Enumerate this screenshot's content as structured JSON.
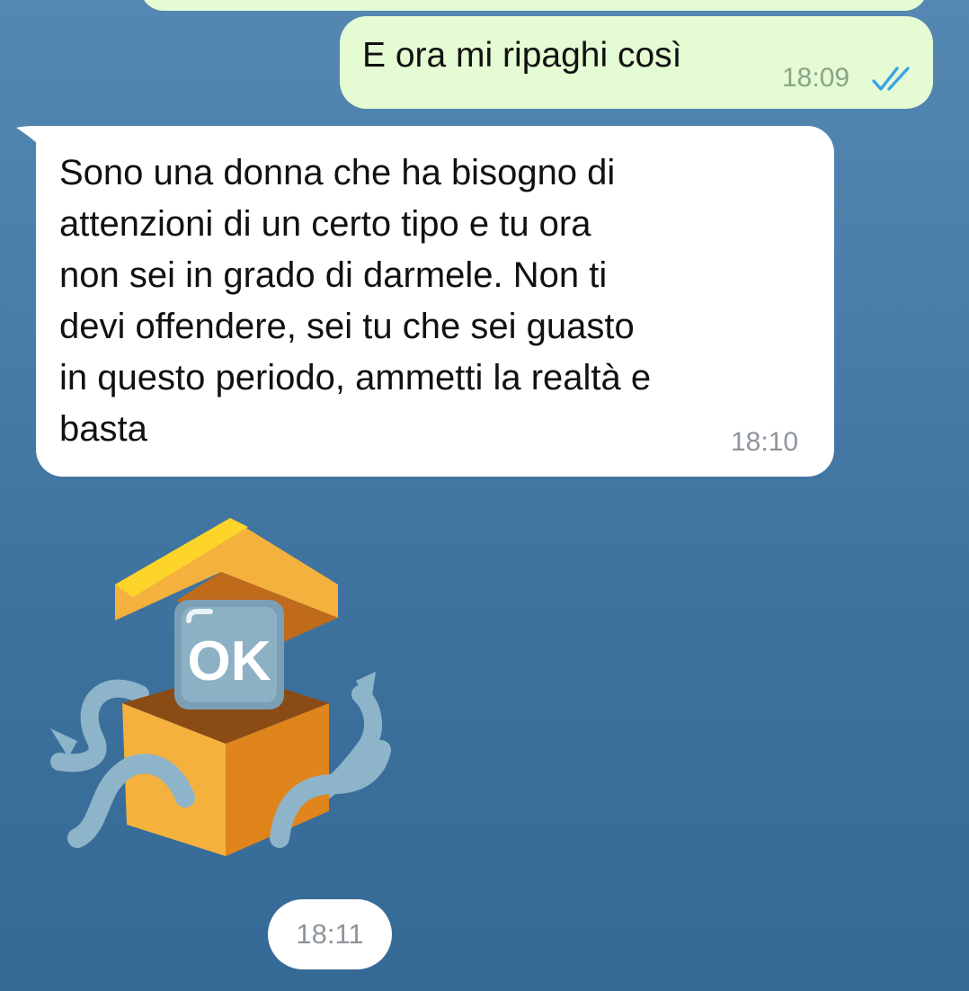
{
  "chat": {
    "messages": [
      {
        "direction": "outgoing",
        "text": "E ora mi ripaghi così",
        "time": "18:09",
        "status": "read-double-check-icon"
      },
      {
        "direction": "incoming",
        "text": "Sono una donna che ha bisogno di\nattenzioni di un certo tipo e tu ora\nnon sei in grado di darmele. Non ti\ndevi offendere, sei tu che sei guasto\nin questo periodo, ammetti la realtà e\nbasta",
        "time": "18:10"
      },
      {
        "direction": "incoming",
        "type": "sticker",
        "sticker_text": "OK",
        "sticker_icon": "ok-gift-box-sticker",
        "time": "18:11"
      }
    ]
  },
  "colors": {
    "background": "#4a7eaa",
    "outgoing_bubble": "#e4fbd3",
    "incoming_bubble": "#ffffff",
    "check_marks": "#3aa3e8"
  }
}
